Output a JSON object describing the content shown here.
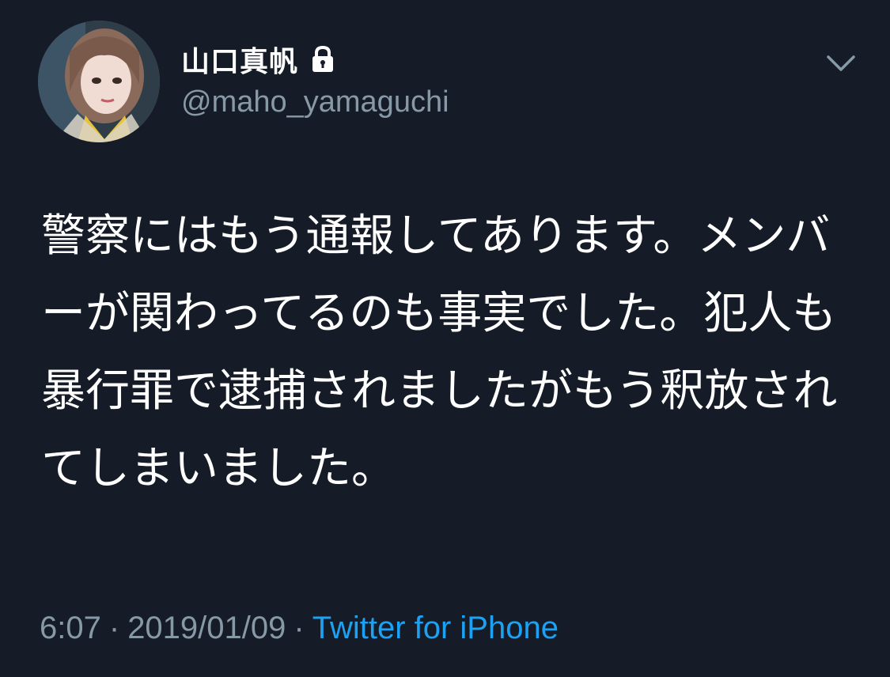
{
  "tweet": {
    "display_name": "山口真帆",
    "handle": "@maho_yamaguchi",
    "text": "警察にはもう通報してあります。メンバーが関わってるのも事実でした。犯人も暴行罪で逮捕されましたがもう釈放されてしまいました。",
    "time": "6:07",
    "separator": "·",
    "date": "2019/01/09",
    "source": "Twitter for iPhone",
    "protected": true
  },
  "icons": {
    "lock": "lock-icon",
    "menu": "chevron-down-icon"
  },
  "colors": {
    "background": "#151c27",
    "text": "#ffffff",
    "muted": "#8899a6",
    "link": "#1da1f2"
  }
}
